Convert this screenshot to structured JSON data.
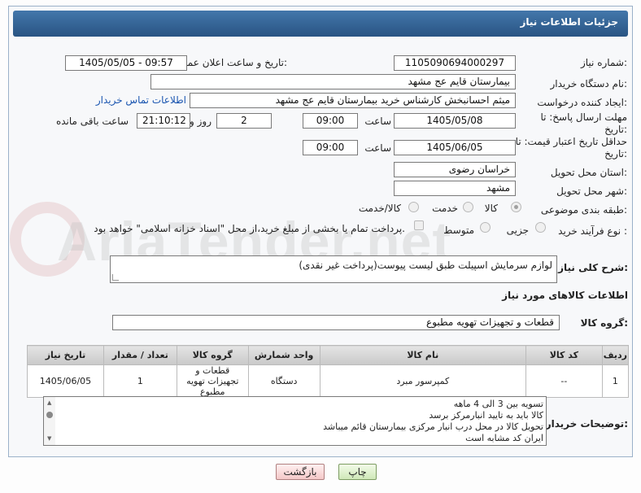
{
  "header": {
    "title": "جزئیات اطلاعات نیاز"
  },
  "fields": {
    "need_number_label": "شماره نیاز:",
    "need_number": "1105090694000297",
    "announce_label": "تاریخ و ساعت اعلان عمومی:",
    "announce_value": "1405/05/05 - 09:57",
    "buyer_org_label": "نام دستگاه خریدار:",
    "buyer_org": "بیمارستان قایم  عج  مشهد",
    "creator_label": "ایجاد کننده درخواست:",
    "creator": "میثم احسانبخش کارشناس خرید بیمارستان قایم  عج  مشهد",
    "contact_link": "اطلاعات تماس خریدار",
    "reply_deadline_label": "مهلت ارسال پاسخ: تا تاریخ:",
    "reply_date": "1405/05/08",
    "time_label": "ساعت",
    "reply_time": "09:00",
    "days_count": "2",
    "days_label": "روز و",
    "remaining_time": "21:10:12",
    "remaining_label": "ساعت باقی مانده",
    "price_validity_label": "حداقل تاریخ اعتبار قیمت: تا تاریخ:",
    "price_date": "1405/06/05",
    "price_time": "09:00",
    "province_label": "استان محل تحویل:",
    "province": "خراسان رضوی",
    "city_label": "شهر محل تحویل:",
    "city": "مشهد",
    "category_label": "طبقه بندی موضوعی:",
    "category_options": [
      "کالا",
      "خدمت",
      "کالا/خدمت"
    ],
    "process_label": "نوع فرآیند خرید :",
    "process_options": [
      "جزیی",
      "متوسط"
    ],
    "payment_note": "پرداخت تمام یا بخشی از مبلغ خرید،از محل \"اسناد خزانه اسلامی\" خواهد بود."
  },
  "description": {
    "label": "شرح کلی نیاز:",
    "text": "لوازم سرمایش اسپیلت طبق لیست پیوست(پرداخت غیر نقدی)"
  },
  "goods": {
    "section_title": "اطلاعات کالاهای مورد نیاز",
    "group_label": "گروه کالا:",
    "group_value": "قطعات و تجهیزات تهویه مطبوع",
    "columns": [
      "ردیف",
      "کد کالا",
      "نام کالا",
      "واحد شمارش",
      "گروه کالا",
      "تعداد / مقدار",
      "تاریخ نیاز"
    ],
    "rows": [
      {
        "row": "1",
        "code": "--",
        "name": "کمپرسور مبرد",
        "unit": "دستگاه",
        "group": "قطعات و تجهیزات تهویه مطبوع",
        "qty": "1",
        "date": "1405/06/05"
      }
    ]
  },
  "buyer_notes": {
    "label": "توضیحات خریدار:",
    "lines": [
      "تسویه بین 3 الی 4 ماهه",
      "کالا باید به تایید انبارمرکز برسد",
      "تحویل کالا در محل درب انبار مرکزی بیمارستان قائم میباشد",
      "ایران کد مشابه است"
    ]
  },
  "buttons": {
    "print": "چاپ",
    "back": "بازگشت"
  },
  "watermark": "AriaTender.net"
}
